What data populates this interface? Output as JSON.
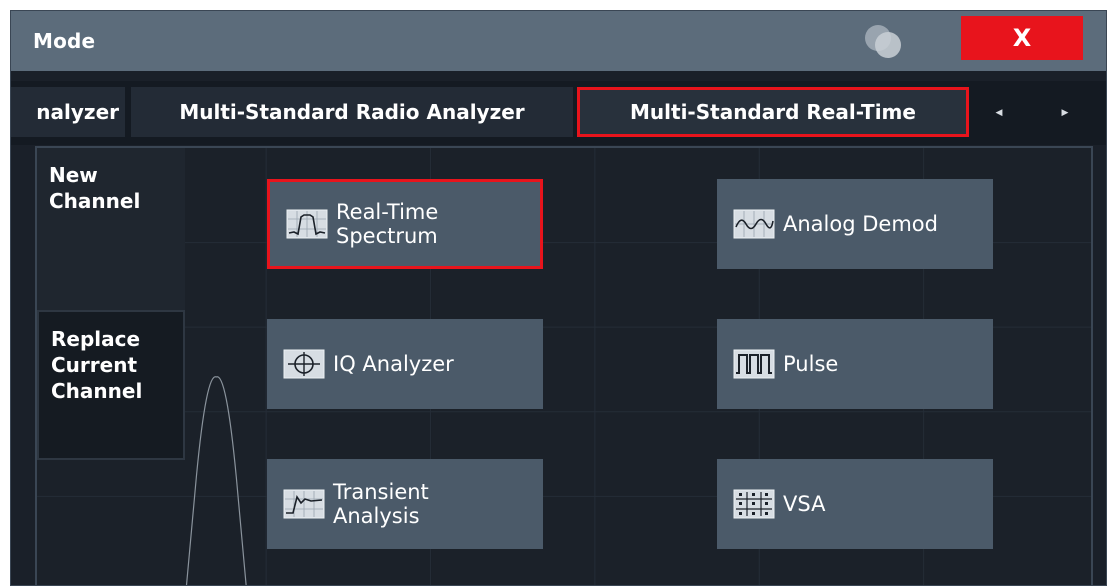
{
  "dialog": {
    "title": "Mode",
    "close_label": "X"
  },
  "tabs": [
    {
      "label": "nalyzer"
    },
    {
      "label": "Multi-Standard Radio Analyzer"
    },
    {
      "label": "Multi-Standard Real-Time",
      "selected": true
    }
  ],
  "tab_arrows": {
    "left": "◀",
    "right": "▶"
  },
  "side_panel": {
    "new_channel": "New\nChannel",
    "replace_channel": "Replace\nCurrent\nChannel"
  },
  "modes": [
    {
      "label": "Real-Time\nSpectrum",
      "icon": "spectrum-icon",
      "selected": true
    },
    {
      "label": "Analog Demod",
      "icon": "analog-demod-icon"
    },
    {
      "label": "IQ Analyzer",
      "icon": "iq-analyzer-icon"
    },
    {
      "label": "Pulse",
      "icon": "pulse-icon"
    },
    {
      "label": "Transient\nAnalysis",
      "icon": "transient-icon"
    },
    {
      "label": "VSA",
      "icon": "vsa-icon"
    }
  ],
  "colors": {
    "accent": "#e8141c",
    "titlebar": "#5c6c7b",
    "button": "#4b5a69",
    "background": "#1a2029"
  }
}
